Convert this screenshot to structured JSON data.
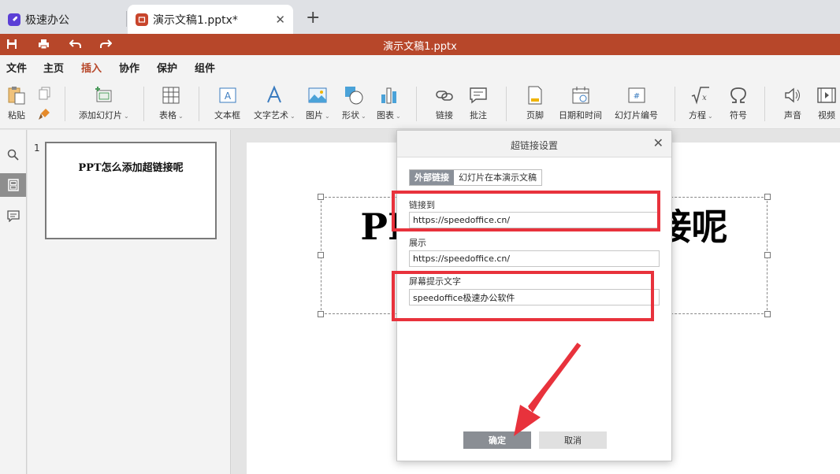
{
  "browser": {
    "tabs": [
      {
        "title": "极速办公",
        "active": false
      },
      {
        "title": "演示文稿1.pptx*",
        "active": true
      }
    ],
    "new_tab": "+",
    "close_glyph": "✕"
  },
  "titlebar": {
    "doc_title": "演示文稿1.pptx",
    "quick_actions": [
      "save-icon",
      "print-icon",
      "undo-icon",
      "redo-icon"
    ],
    "color": "#b7472a"
  },
  "menu": {
    "items": [
      "文件",
      "主页",
      "插入",
      "协作",
      "保护",
      "组件"
    ],
    "active": "插入"
  },
  "ribbon": {
    "paste": "粘贴",
    "add_slide": "添加幻灯片",
    "table": "表格",
    "textbox": "文本框",
    "wordart": "文字艺术",
    "image": "图片",
    "shape": "形状",
    "chart": "图表",
    "link": "链接",
    "comment": "批注",
    "footer": "页脚",
    "datetime": "日期和时间",
    "slide_number": "幻灯片编号",
    "equation": "方程",
    "symbol": "符号",
    "audio": "声音",
    "video": "视频",
    "dropdown_glyph": "⌄"
  },
  "thumbnails": [
    {
      "number": "1",
      "title": "PPT怎么添加超链接呢"
    }
  ],
  "slide": {
    "title_left": "PP",
    "title_right": "接呢"
  },
  "dialog": {
    "title": "超链接设置",
    "close": "✕",
    "tabs": [
      "外部链接",
      "幻灯片在本演示文稿"
    ],
    "link_to_label": "链接到",
    "link_to_value": "https://speedoffice.cn/",
    "display_label": "展示",
    "display_value": "https://speedoffice.cn/",
    "tooltip_label": "屏幕提示文字",
    "tooltip_value": "speedoffice极速办公软件",
    "ok": "确定",
    "cancel": "取消"
  },
  "annotation_color": "#e8323c"
}
